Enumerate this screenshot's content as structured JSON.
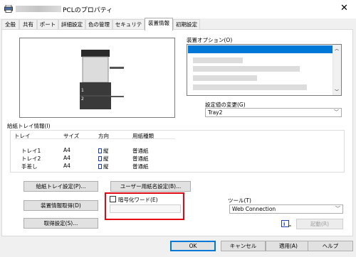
{
  "window": {
    "title_suffix": "PCLのプロパティ",
    "close_glyph": "✕"
  },
  "tabs": [
    {
      "label": "全般"
    },
    {
      "label": "共有"
    },
    {
      "label": "ポート"
    },
    {
      "label": "詳細設定"
    },
    {
      "label": "色の管理"
    },
    {
      "label": "セキュリティ"
    },
    {
      "label": "装置情報",
      "active": true
    },
    {
      "label": "初期設定"
    }
  ],
  "preview": {
    "tray_numbers": [
      "1",
      "2"
    ]
  },
  "device_options": {
    "label": "装置オプション(O)",
    "change_setting_label": "設定値の変更(G)",
    "selected_value": "Tray2"
  },
  "paper_tray": {
    "label": "給紙トレイ情報(I)",
    "columns": [
      "トレイ",
      "サイズ",
      "方向",
      "用紙種類"
    ],
    "rows": [
      [
        "トレイ1",
        "A4",
        "縦",
        "普通紙"
      ],
      [
        "トレイ2",
        "A4",
        "縦",
        "普通紙"
      ],
      [
        "手差し",
        "A4",
        "縦",
        "普通紙"
      ]
    ],
    "settings_button": "給紙トレイ設定(P)...",
    "user_paper_button": "ユーザー用紙名設定(B)..."
  },
  "acquire": {
    "device_info_button": "装置情報取得(D)",
    "acquire_settings_button": "取得設定(S)..."
  },
  "encryption": {
    "checkbox_label": "暗号化ワード(E)",
    "checked": false
  },
  "tools": {
    "label": "ツール(T)",
    "selected": "Web Connection",
    "launch_button": "起動(R)"
  },
  "dialog_buttons": {
    "ok": "OK",
    "cancel": "キャンセル",
    "apply": "適用(A)",
    "help": "ヘルプ"
  },
  "colors": {
    "highlight": "#e30613",
    "selection": "#0078d7"
  }
}
